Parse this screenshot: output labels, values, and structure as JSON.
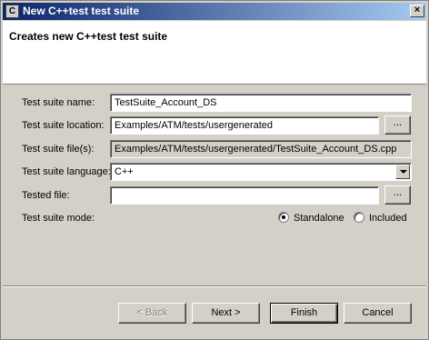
{
  "window": {
    "title": "New C++test test suite",
    "close_label": "×",
    "icon_label": "C"
  },
  "header": {
    "description": "Creates new C++test test suite"
  },
  "form": {
    "suite_name": {
      "label": "Test suite name:",
      "value": "TestSuite_Account_DS"
    },
    "suite_location": {
      "label": "Test suite location:",
      "value": "Examples/ATM/tests/usergenerated",
      "browse_label": "..."
    },
    "suite_files": {
      "label": "Test suite file(s):",
      "value": "Examples/ATM/tests/usergenerated/TestSuite_Account_DS.cpp"
    },
    "suite_language": {
      "label": "Test suite language:",
      "value": "C++"
    },
    "tested_file": {
      "label": "Tested file:",
      "value": "",
      "browse_label": "..."
    },
    "suite_mode": {
      "label": "Test suite mode:",
      "options": [
        "Standalone",
        "Included"
      ],
      "selected": "Standalone"
    }
  },
  "buttons": {
    "back": "< Back",
    "next": "Next >",
    "finish": "Finish",
    "cancel": "Cancel"
  }
}
